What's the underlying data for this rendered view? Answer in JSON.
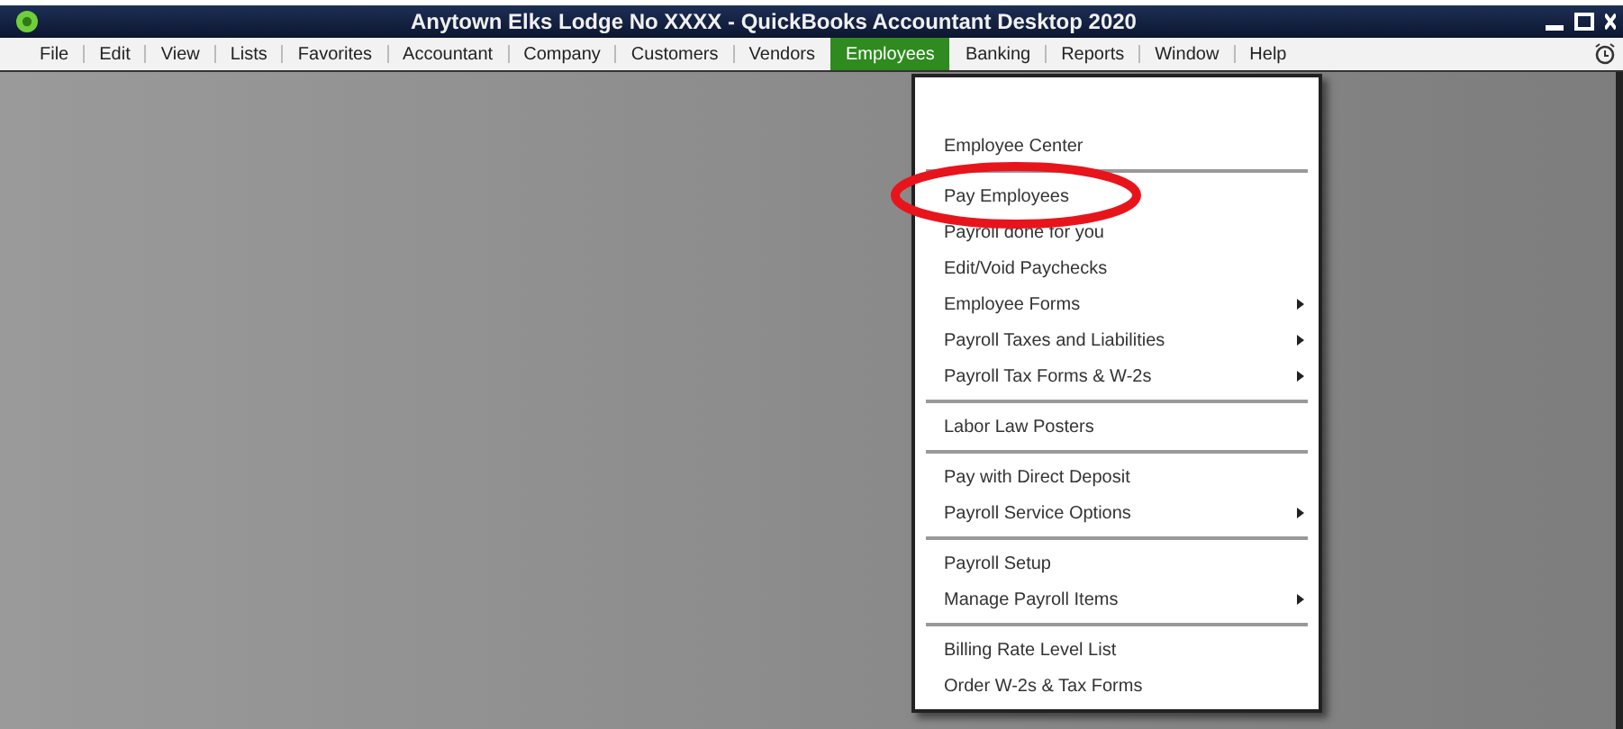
{
  "window": {
    "title": "Anytown Elks Lodge No XXXX - QuickBooks Accountant Desktop 2020"
  },
  "menu_bar": [
    {
      "label": "File",
      "selected": false
    },
    {
      "label": "Edit",
      "selected": false
    },
    {
      "label": "View",
      "selected": false
    },
    {
      "label": "Lists",
      "selected": false
    },
    {
      "label": "Favorites",
      "selected": false
    },
    {
      "label": "Accountant",
      "selected": false
    },
    {
      "label": "Company",
      "selected": false
    },
    {
      "label": "Customers",
      "selected": false
    },
    {
      "label": "Vendors",
      "selected": false
    },
    {
      "label": "Employees",
      "selected": true
    },
    {
      "label": "Banking",
      "selected": false
    },
    {
      "label": "Reports",
      "selected": false
    },
    {
      "label": "Window",
      "selected": false
    },
    {
      "label": "Help",
      "selected": false
    }
  ],
  "dropdown": {
    "groups": [
      [
        {
          "label": "Employee Center",
          "submenu": false
        }
      ],
      [
        {
          "label": "Pay Employees",
          "submenu": false
        },
        {
          "label": "Payroll done for you",
          "submenu": false
        },
        {
          "label": "Edit/Void Paychecks",
          "submenu": false
        },
        {
          "label": "Employee Forms",
          "submenu": true
        },
        {
          "label": "Payroll Taxes and Liabilities",
          "submenu": true
        },
        {
          "label": "Payroll Tax Forms & W-2s",
          "submenu": true
        }
      ],
      [
        {
          "label": "Labor Law Posters",
          "submenu": false
        }
      ],
      [
        {
          "label": "Pay with Direct Deposit",
          "submenu": false
        },
        {
          "label": "Payroll Service Options",
          "submenu": true
        }
      ],
      [
        {
          "label": "Payroll Setup",
          "submenu": false
        },
        {
          "label": "Manage Payroll Items",
          "submenu": true
        }
      ],
      [
        {
          "label": "Billing Rate Level List",
          "submenu": false
        },
        {
          "label": "Order W-2s & Tax Forms",
          "submenu": false
        }
      ]
    ]
  }
}
